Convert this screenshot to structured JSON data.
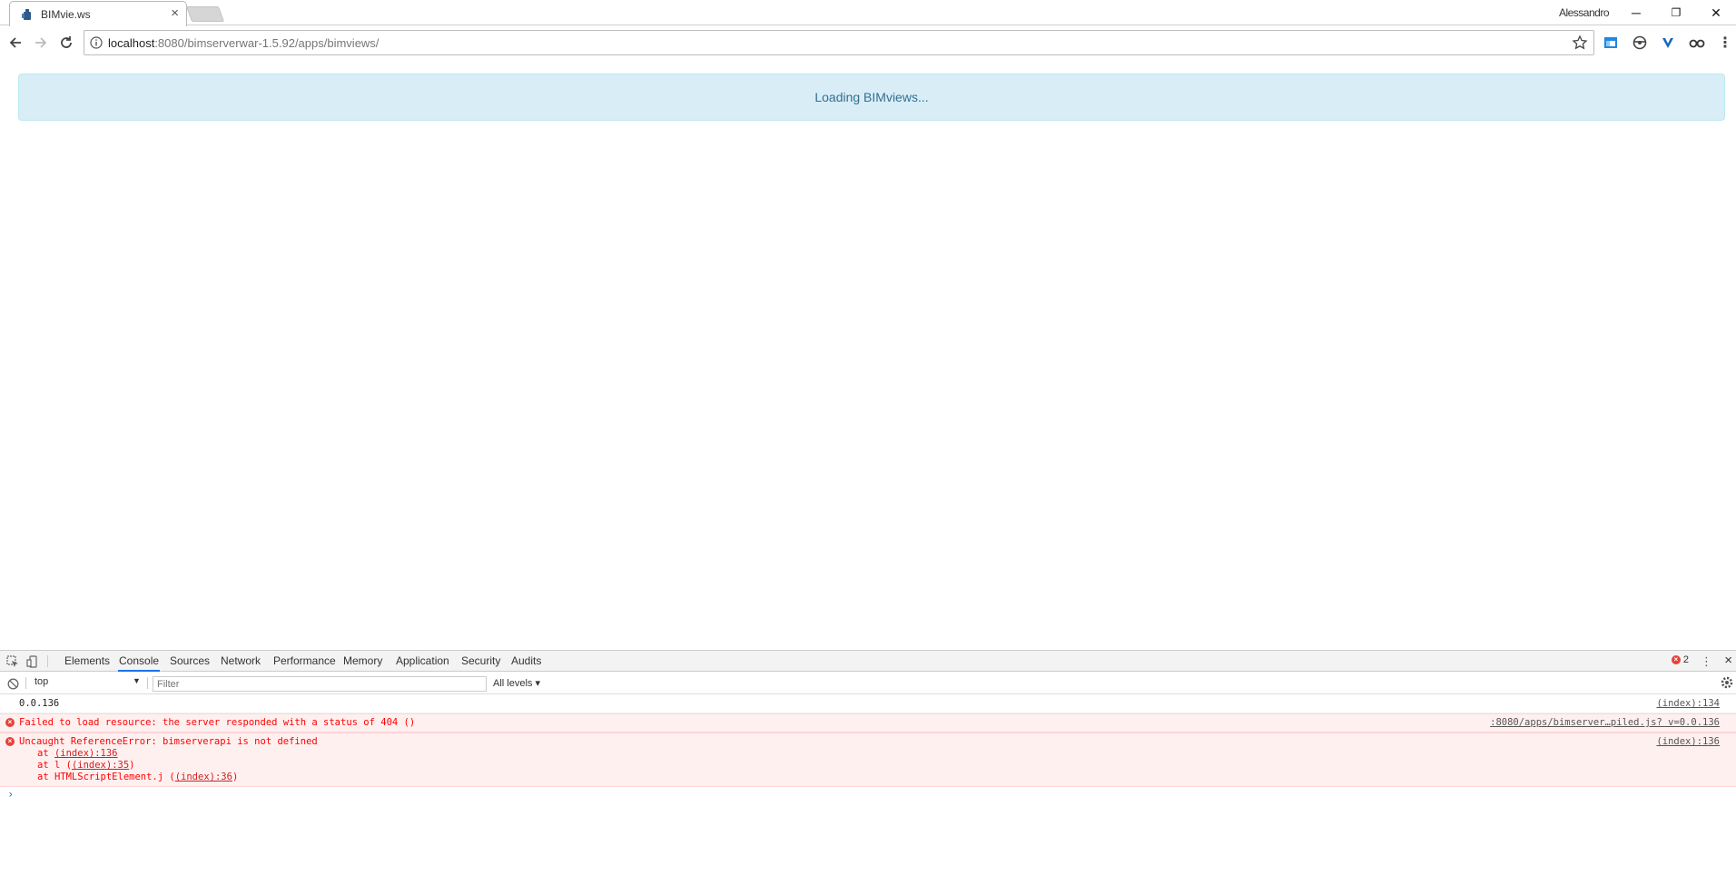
{
  "browser": {
    "tab_title": "BIMvie.ws",
    "profile_name": "Alessandro",
    "url_host": "localhost",
    "url_rest": ":8080/bimserverwar-1.5.92/apps/bimviews/",
    "window_controls": {
      "minimize": "─",
      "restore": "❐",
      "close": "✕"
    }
  },
  "page": {
    "loading_text": "Loading BIMviews..."
  },
  "devtools": {
    "tabs": [
      "Elements",
      "Console",
      "Sources",
      "Network",
      "Performance",
      "Memory",
      "Application",
      "Security",
      "Audits"
    ],
    "active_tab": "Console",
    "error_count": "2",
    "context": "top",
    "filter_placeholder": "Filter",
    "levels": "All levels",
    "logs": [
      {
        "text": "0.0.136",
        "source": "(index):134",
        "level": "info"
      },
      {
        "text": "Failed to load resource: the server responded with a status of 404 ()",
        "source": ":8080/apps/bimserver…piled.js? v=0.0.136",
        "level": "error"
      },
      {
        "text": "Uncaught ReferenceError: bimserverapi is not defined",
        "source": "(index):136",
        "level": "error"
      }
    ],
    "stack": [
      {
        "prefix": "at ",
        "link": "(index):136",
        "suffix": ""
      },
      {
        "prefix": "at l (",
        "link": "(index):35",
        "suffix": ")"
      },
      {
        "prefix": "at HTMLScriptElement.j (",
        "link": "(index):36",
        "suffix": ")"
      }
    ]
  },
  "colors": {
    "alert_bg": "#d9edf7",
    "alert_text": "#31708f",
    "error_red": "#e5423a",
    "active_tab_underline": "#1a73e8"
  }
}
